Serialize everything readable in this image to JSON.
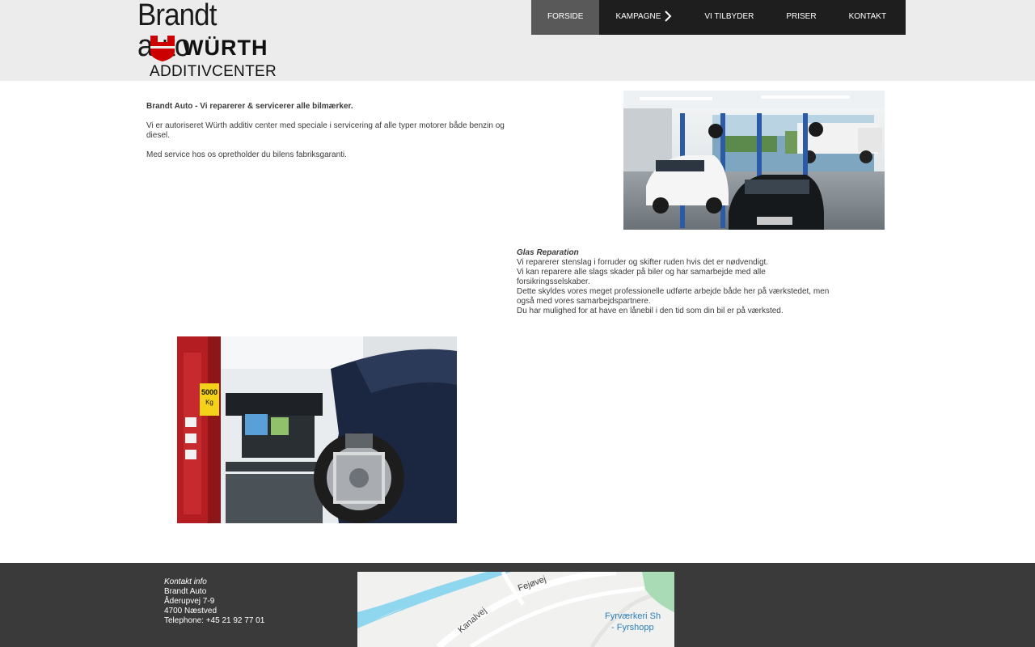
{
  "header": {
    "brand": "Brandt auto",
    "partner_logo": "WÜRTH",
    "partner_sub": "ADDITIVCENTER"
  },
  "nav": {
    "items": [
      {
        "label": "FORSIDE",
        "active": true
      },
      {
        "label": "KAMPAGNE",
        "has_submenu": true,
        "icon": "chevron-right-icon"
      },
      {
        "label": "VI TILBYDER"
      },
      {
        "label": "PRISER"
      },
      {
        "label": "KONTAKT"
      }
    ]
  },
  "intro": {
    "headline": "Brandt Auto - Vi reparerer & servicerer alle bilmærker.",
    "paragraph1": "Vi er autoriseret Würth additiv center med speciale i servicering af alle typer motorer både benzin og diesel.",
    "paragraph2": "Med service hos os opretholder du bilens fabriksgaranti."
  },
  "glass": {
    "title": "Glas Reparation",
    "lines": [
      "Vi reparerer stenslag i forruder og skifter ruden hvis det er nødvendigt.",
      "Vi kan reparere alle slags skader på biler og har samarbejde med alle forsikringsselskaber.",
      "Dette skyldes vores meget professionelle udførte arbejde både her på værkstedet, men også med vores samarbejdspartnere.",
      "Du har mulighed for at have en lånebil i den tid som din bil er på værksted."
    ]
  },
  "alignment_photo": {
    "lift_label_top": "5000",
    "lift_label_bottom": "Kg"
  },
  "footer": {
    "contact": {
      "title": "Kontakt info",
      "name": "Brandt Auto",
      "street": "Åderupvej 7-9",
      "city": "4700 Næstved",
      "phone": "Telephone: +45 21 92 77 01"
    },
    "map": {
      "road1": "Fejøvej",
      "road2": "Kanalvej",
      "poi_line1": "Fyrværkeri Sh",
      "poi_line2": "- Fyrshopp"
    }
  },
  "colors": {
    "header_bg": "#ececec",
    "nav_bg": "#1e1e1e",
    "nav_active": "#595959",
    "footer_bg": "#3a3a3a",
    "wurth_red": "#cc0000",
    "map_water": "#8fd6ef"
  }
}
